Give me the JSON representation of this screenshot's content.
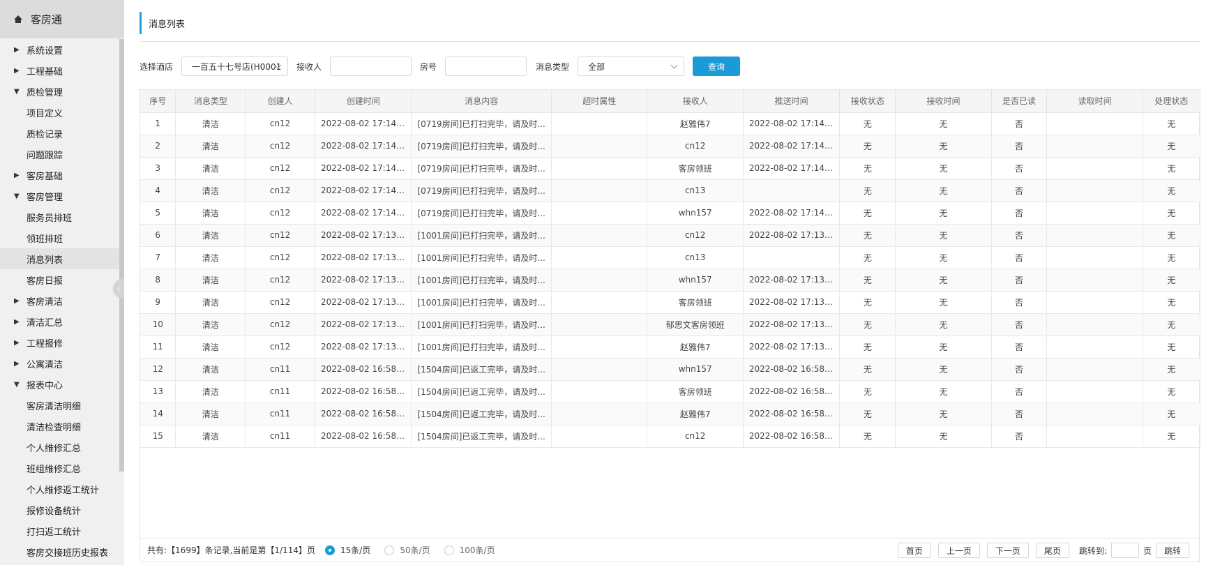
{
  "sidebar": {
    "title": "客房通",
    "menu": [
      {
        "label": "系统设置",
        "type": "group",
        "expanded": false
      },
      {
        "label": "工程基础",
        "type": "group",
        "expanded": false
      },
      {
        "label": "质检管理",
        "type": "group",
        "expanded": true
      },
      {
        "label": "项目定义",
        "type": "child"
      },
      {
        "label": "质检记录",
        "type": "child"
      },
      {
        "label": "问题跟踪",
        "type": "child"
      },
      {
        "label": "客房基础",
        "type": "group",
        "expanded": false
      },
      {
        "label": "客房管理",
        "type": "group",
        "expanded": true
      },
      {
        "label": "服务员排班",
        "type": "child"
      },
      {
        "label": "领班排班",
        "type": "child"
      },
      {
        "label": "消息列表",
        "type": "child",
        "active": true
      },
      {
        "label": "客房日报",
        "type": "child"
      },
      {
        "label": "客房清洁",
        "type": "group",
        "expanded": false
      },
      {
        "label": "清洁汇总",
        "type": "group",
        "expanded": false
      },
      {
        "label": "工程报修",
        "type": "group",
        "expanded": false
      },
      {
        "label": "公寓清洁",
        "type": "group",
        "expanded": false
      },
      {
        "label": "报表中心",
        "type": "group",
        "expanded": true
      },
      {
        "label": "客房清洁明细",
        "type": "child"
      },
      {
        "label": "清洁检查明细",
        "type": "child"
      },
      {
        "label": "个人维修汇总",
        "type": "child"
      },
      {
        "label": "班组维修汇总",
        "type": "child"
      },
      {
        "label": "个人维修返工统计",
        "type": "child"
      },
      {
        "label": "报修设备统计",
        "type": "child"
      },
      {
        "label": "打扫返工统计",
        "type": "child"
      },
      {
        "label": "客房交接班历史报表",
        "type": "child"
      }
    ]
  },
  "page": {
    "title": "消息列表"
  },
  "filters": {
    "hotel_label": "选择酒店",
    "hotel_value": "一百五十七号店(H0001",
    "receiver_label": "接收人",
    "receiver_value": "",
    "room_label": "房号",
    "room_value": "",
    "type_label": "消息类型",
    "type_value": "全部",
    "query_button": "查询"
  },
  "table": {
    "columns": [
      "序号",
      "消息类型",
      "创建人",
      "创建时间",
      "消息内容",
      "超时属性",
      "接收人",
      "推送时间",
      "接收状态",
      "接收时间",
      "是否已读",
      "读取时间",
      "处理状态"
    ],
    "rows": [
      [
        "1",
        "清洁",
        "cn12",
        "2022-08-02 17:14:...",
        "[0719房间]已打扫完毕，请及时...",
        "",
        "赵雅伟7",
        "2022-08-02 17:14:...",
        "无",
        "无",
        "否",
        "",
        "无"
      ],
      [
        "2",
        "清洁",
        "cn12",
        "2022-08-02 17:14:...",
        "[0719房间]已打扫完毕，请及时...",
        "",
        "cn12",
        "2022-08-02 17:14:...",
        "无",
        "无",
        "否",
        "",
        "无"
      ],
      [
        "3",
        "清洁",
        "cn12",
        "2022-08-02 17:14:...",
        "[0719房间]已打扫完毕，请及时...",
        "",
        "客房领班",
        "2022-08-02 17:14:...",
        "无",
        "无",
        "否",
        "",
        "无"
      ],
      [
        "4",
        "清洁",
        "cn12",
        "2022-08-02 17:14:...",
        "[0719房间]已打扫完毕，请及时...",
        "",
        "cn13",
        "",
        "无",
        "无",
        "否",
        "",
        "无"
      ],
      [
        "5",
        "清洁",
        "cn12",
        "2022-08-02 17:14:...",
        "[0719房间]已打扫完毕，请及时...",
        "",
        "whn157",
        "2022-08-02 17:14:...",
        "无",
        "无",
        "否",
        "",
        "无"
      ],
      [
        "6",
        "清洁",
        "cn12",
        "2022-08-02 17:13:...",
        "[1001房间]已打扫完毕，请及时...",
        "",
        "cn12",
        "2022-08-02 17:13:...",
        "无",
        "无",
        "否",
        "",
        "无"
      ],
      [
        "7",
        "清洁",
        "cn12",
        "2022-08-02 17:13:...",
        "[1001房间]已打扫完毕，请及时...",
        "",
        "cn13",
        "",
        "无",
        "无",
        "否",
        "",
        "无"
      ],
      [
        "8",
        "清洁",
        "cn12",
        "2022-08-02 17:13:...",
        "[1001房间]已打扫完毕，请及时...",
        "",
        "whn157",
        "2022-08-02 17:13:...",
        "无",
        "无",
        "否",
        "",
        "无"
      ],
      [
        "9",
        "清洁",
        "cn12",
        "2022-08-02 17:13:...",
        "[1001房间]已打扫完毕，请及时...",
        "",
        "客房领班",
        "2022-08-02 17:13:...",
        "无",
        "无",
        "否",
        "",
        "无"
      ],
      [
        "10",
        "清洁",
        "cn12",
        "2022-08-02 17:13:...",
        "[1001房间]已打扫完毕，请及时...",
        "",
        "郁思文客房领班",
        "2022-08-02 17:13:...",
        "无",
        "无",
        "否",
        "",
        "无"
      ],
      [
        "11",
        "清洁",
        "cn12",
        "2022-08-02 17:13:...",
        "[1001房间]已打扫完毕，请及时...",
        "",
        "赵雅伟7",
        "2022-08-02 17:13:...",
        "无",
        "无",
        "否",
        "",
        "无"
      ],
      [
        "12",
        "清洁",
        "cn11",
        "2022-08-02 16:58:...",
        "[1504房间]已返工完毕，请及时...",
        "",
        "whn157",
        "2022-08-02 16:58:...",
        "无",
        "无",
        "否",
        "",
        "无"
      ],
      [
        "13",
        "清洁",
        "cn11",
        "2022-08-02 16:58:...",
        "[1504房间]已返工完毕，请及时...",
        "",
        "客房领班",
        "2022-08-02 16:58:...",
        "无",
        "无",
        "否",
        "",
        "无"
      ],
      [
        "14",
        "清洁",
        "cn11",
        "2022-08-02 16:58:...",
        "[1504房间]已返工完毕，请及时...",
        "",
        "赵雅伟7",
        "2022-08-02 16:58:...",
        "无",
        "无",
        "否",
        "",
        "无"
      ],
      [
        "15",
        "清洁",
        "cn11",
        "2022-08-02 16:58:...",
        "[1504房间]已返工完毕，请及时...",
        "",
        "cn12",
        "2022-08-02 16:58:...",
        "无",
        "无",
        "否",
        "",
        "无"
      ]
    ]
  },
  "pager": {
    "summary": "共有:【1699】条记录,当前是第【1/114】页",
    "size_15": "15条/页",
    "size_50": "50条/页",
    "size_100": "100条/页",
    "first": "首页",
    "prev": "上一页",
    "next": "下一页",
    "last": "尾页",
    "jump_label": "跳转到:",
    "page_unit": "页",
    "jump_button": "跳转",
    "jump_value": ""
  },
  "colors": {
    "accent": "#1a9ad6",
    "sidebar_bg": "#f0f0f0",
    "sidebar_head_bg": "#dcdcdc"
  }
}
